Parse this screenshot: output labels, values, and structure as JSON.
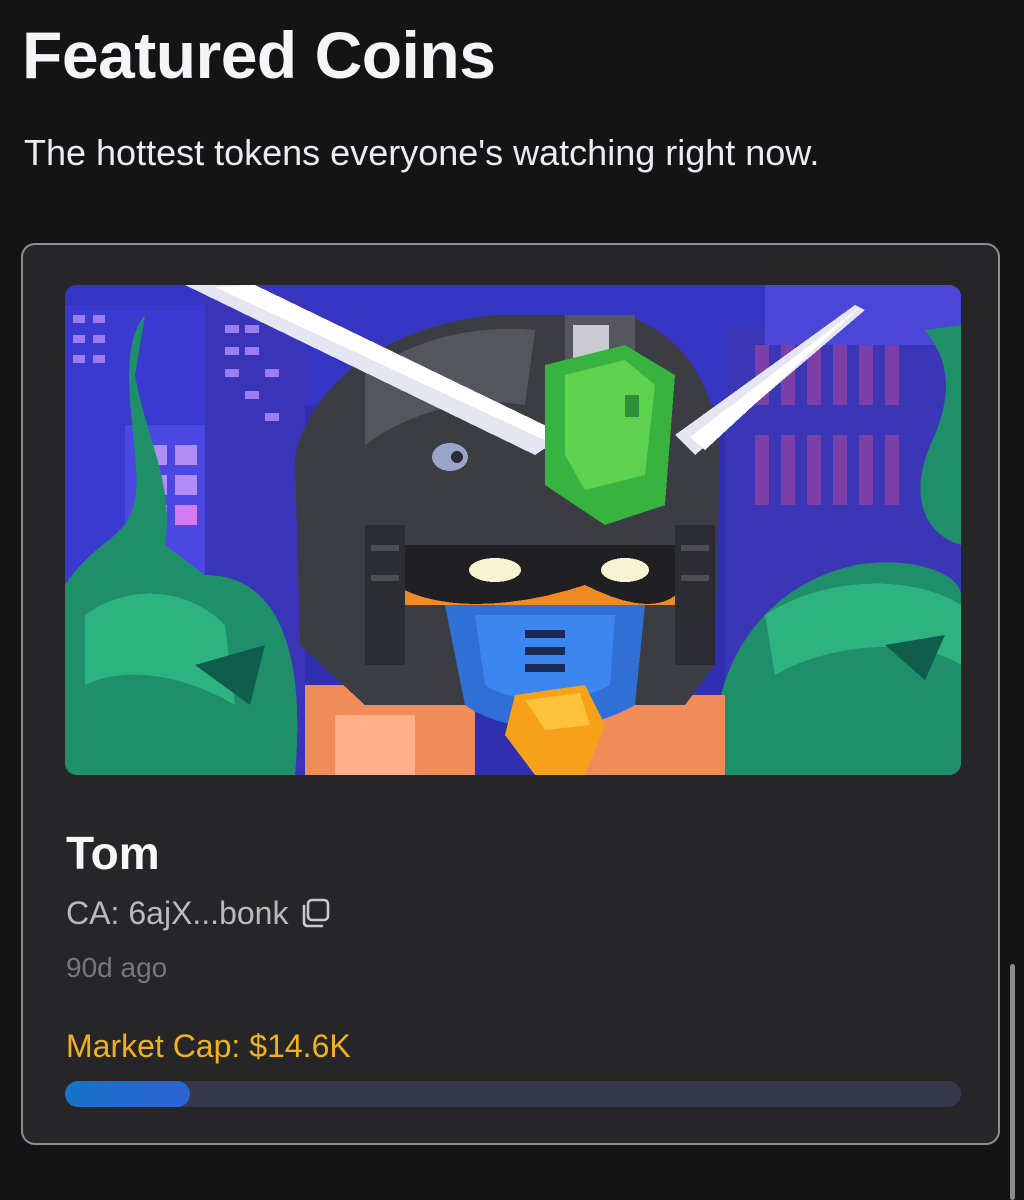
{
  "header": {
    "title": "Featured Coins",
    "subtitle": "The hottest tokens everyone's watching right now."
  },
  "coin": {
    "name": "Tom",
    "ca_prefix": "CA:",
    "ca_value": "6ajX...bonk",
    "age": "90d ago",
    "market_cap_label": "Market Cap:",
    "market_cap_value": "$14.6K",
    "progress": 0.14,
    "icons": {
      "copy": "copy-icon"
    }
  },
  "colors": {
    "accent_gold": "#f0b21c",
    "progress_fill": "#1773c7",
    "progress_track": "#35384a",
    "card_bg": "#262628",
    "page_bg": "#141415"
  }
}
